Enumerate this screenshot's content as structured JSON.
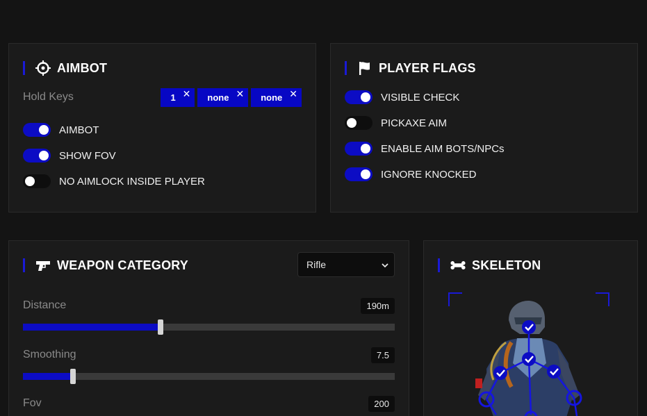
{
  "aimbot": {
    "title": "AIMBOT",
    "hold_keys_label": "Hold Keys",
    "keys": [
      "1",
      "none",
      "none"
    ],
    "remove_glyph": "✕",
    "toggles": [
      {
        "label": "AIMBOT",
        "on": true
      },
      {
        "label": "SHOW FOV",
        "on": true
      },
      {
        "label": "NO AIMLOCK INSIDE PLAYER",
        "on": false
      }
    ]
  },
  "flags": {
    "title": "PLAYER FLAGS",
    "toggles": [
      {
        "label": "VISIBLE CHECK",
        "on": true
      },
      {
        "label": "PICKAXE AIM",
        "on": false
      },
      {
        "label": "ENABLE AIM BOTS/NPCs",
        "on": true
      },
      {
        "label": "IGNORE KNOCKED",
        "on": true
      }
    ]
  },
  "weapon": {
    "title": "WEAPON CATEGORY",
    "selected": "Rifle",
    "sliders": [
      {
        "label": "Distance",
        "value": "190m",
        "fraction": 0.37
      },
      {
        "label": "Smoothing",
        "value": "7.5",
        "fraction": 0.135
      },
      {
        "label": "Fov",
        "value": "200",
        "fraction": 0.5
      }
    ]
  },
  "skeleton": {
    "title": "SKELETON"
  },
  "colors": {
    "accent": "#0c0cc4",
    "panel": "#1b1b1b",
    "background": "#141414"
  }
}
